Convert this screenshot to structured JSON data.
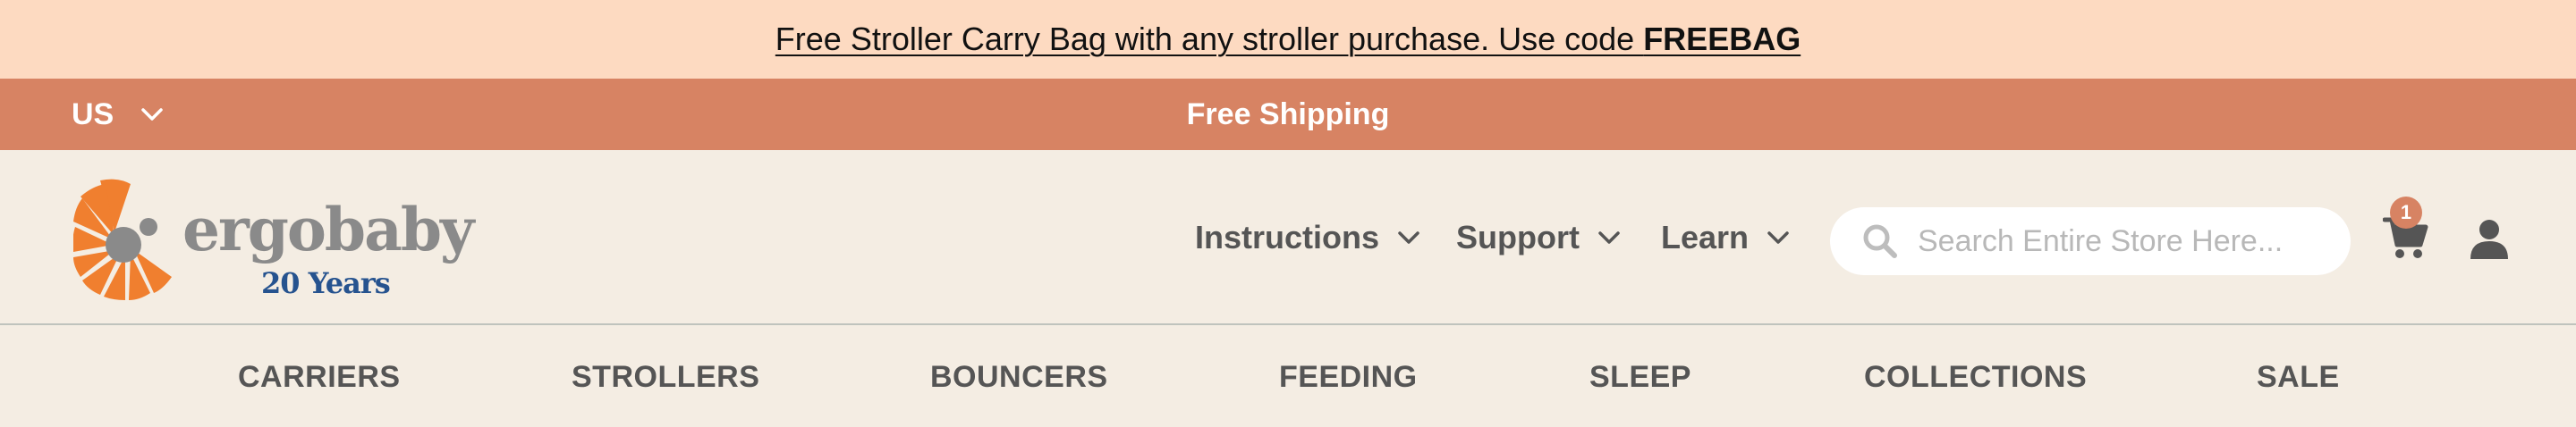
{
  "promo": {
    "text": "Free Stroller Carry Bag with any stroller purchase. Use code ",
    "code": "FREEBAG"
  },
  "topbar": {
    "country": "US",
    "shipping": "Free Shipping",
    "background": "#d78363"
  },
  "logo": {
    "name": "ergobaby",
    "tagline": "20 Years"
  },
  "utility_nav": [
    {
      "label": "Instructions"
    },
    {
      "label": "Support"
    },
    {
      "label": "Learn"
    }
  ],
  "search": {
    "placeholder": "Search Entire Store Here..."
  },
  "cart": {
    "count": "1"
  },
  "main_nav": [
    {
      "label": "CARRIERS"
    },
    {
      "label": "STROLLERS"
    },
    {
      "label": "BOUNCERS"
    },
    {
      "label": "FEEDING"
    },
    {
      "label": "SLEEP"
    },
    {
      "label": "COLLECTIONS"
    },
    {
      "label": "SALE"
    }
  ],
  "colors": {
    "promo_bg": "#fddac1",
    "header_bg": "#f4ede3",
    "accent": "#d78363",
    "logo_orange": "#f07f2f",
    "logo_blue": "#26538f"
  }
}
